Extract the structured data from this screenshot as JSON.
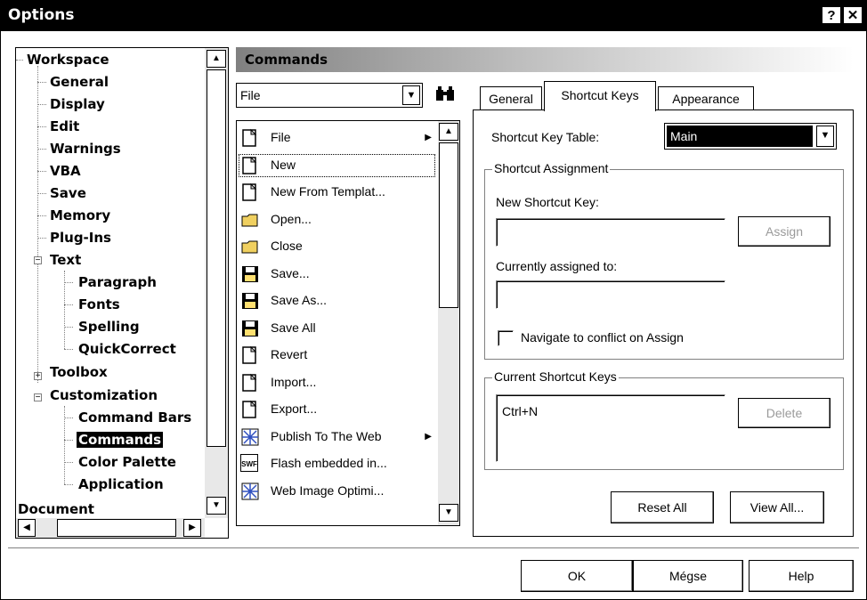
{
  "window": {
    "title": "Options",
    "help_glyph": "?",
    "close_glyph": "✕"
  },
  "tree": {
    "items": [
      {
        "label": "Workspace"
      },
      {
        "label": "General"
      },
      {
        "label": "Display"
      },
      {
        "label": "Edit"
      },
      {
        "label": "Warnings"
      },
      {
        "label": "VBA"
      },
      {
        "label": "Save"
      },
      {
        "label": "Memory"
      },
      {
        "label": "Plug-Ins"
      },
      {
        "label": "Text"
      },
      {
        "label": "Paragraph"
      },
      {
        "label": "Fonts"
      },
      {
        "label": "Spelling"
      },
      {
        "label": "QuickCorrect"
      },
      {
        "label": "Toolbox"
      },
      {
        "label": "Customization"
      },
      {
        "label": "Command Bars"
      },
      {
        "label": "Commands"
      },
      {
        "label": "Color Palette"
      },
      {
        "label": "Application"
      },
      {
        "label": "Document"
      }
    ],
    "selected": "Commands",
    "expand_minus": "−",
    "expand_plus": "+"
  },
  "header": {
    "title": "Commands"
  },
  "category_combo": {
    "value": "File"
  },
  "commands": [
    {
      "label": "File",
      "submenu": "▶",
      "icon": "page-icon"
    },
    {
      "label": "New",
      "icon": "page-icon"
    },
    {
      "label": "New From Templat...",
      "icon": "template-icon"
    },
    {
      "label": "Open...",
      "icon": "folder-open-icon"
    },
    {
      "label": "Close",
      "icon": "folder-close-icon"
    },
    {
      "label": "Save...",
      "icon": "floppy-icon"
    },
    {
      "label": "Save As...",
      "icon": "floppy-icon"
    },
    {
      "label": "Save All",
      "icon": "floppy-icon"
    },
    {
      "label": "Revert",
      "icon": "revert-icon"
    },
    {
      "label": "Import...",
      "icon": "import-icon"
    },
    {
      "label": "Export...",
      "icon": "export-icon"
    },
    {
      "label": "Publish To The Web",
      "submenu": "▶",
      "icon": "web-icon"
    },
    {
      "label": "Flash embedded in...",
      "icon": "swf-icon",
      "icon_text": "SWF"
    },
    {
      "label": "Web Image Optimi...",
      "icon": "web-image-icon"
    }
  ],
  "tabs": [
    {
      "label": "General"
    },
    {
      "label": "Shortcut Keys",
      "active": true
    },
    {
      "label": "Appearance"
    }
  ],
  "shortcut": {
    "table_label": "Shortcut Key Table:",
    "table_value": "Main",
    "assignment_group": "Shortcut Assignment",
    "new_key_label": "New Shortcut Key:",
    "new_key_value": "",
    "assign_button": "Assign",
    "currently_label": "Currently assigned to:",
    "currently_value": "",
    "navigate_label": "Navigate to conflict on Assign",
    "navigate_checked": false,
    "current_group": "Current Shortcut Keys",
    "current_keys": [
      "Ctrl+N"
    ],
    "delete_button": "Delete",
    "reset_all_button": "Reset All",
    "view_all_button": "View All..."
  },
  "footer": {
    "ok": "OK",
    "cancel": "Mégse",
    "help": "Help"
  },
  "colors": {
    "titlebar": "#000000",
    "selection": "#000000",
    "header_gradient_start": "#808080"
  }
}
